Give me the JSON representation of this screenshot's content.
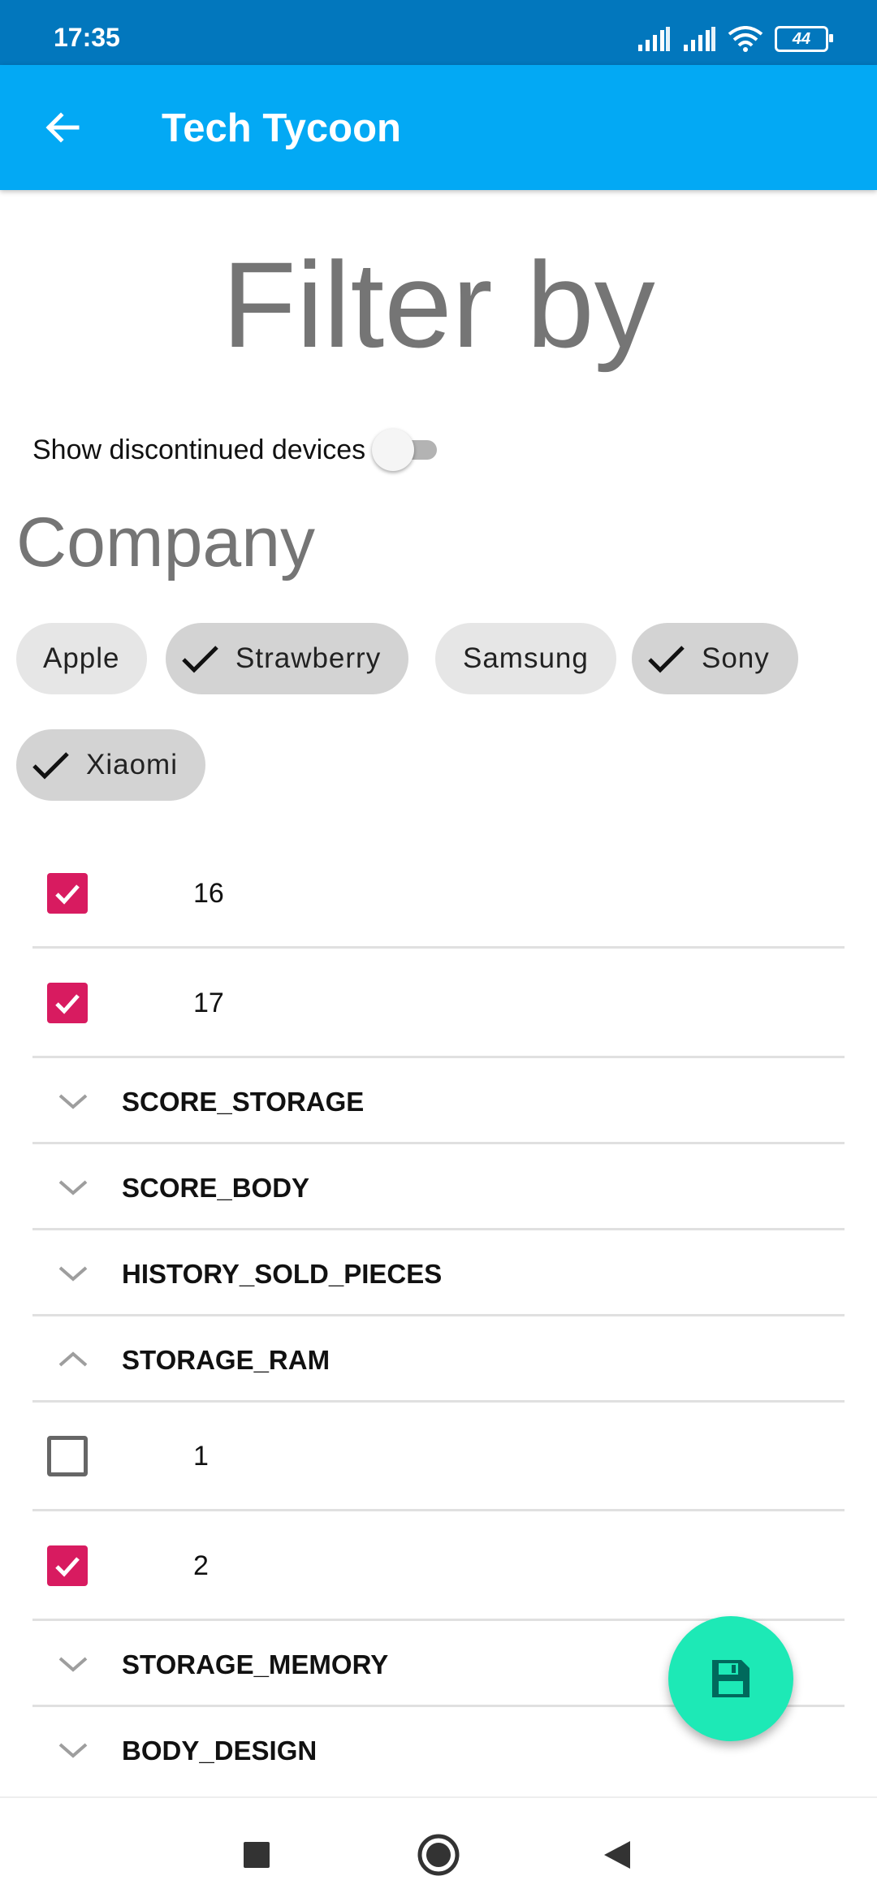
{
  "status_bar": {
    "time": "17:35",
    "battery": "44"
  },
  "app_bar": {
    "title": "Tech Tycoon"
  },
  "filter": {
    "title": "Filter by",
    "show_discontinued_label": "Show discontinued devices",
    "show_discontinued_on": false
  },
  "company": {
    "heading": "Company",
    "chips": [
      {
        "label": "Apple",
        "selected": false
      },
      {
        "label": "Strawberry",
        "selected": true
      },
      {
        "label": "Samsung",
        "selected": false
      },
      {
        "label": "Sony",
        "selected": true
      },
      {
        "label": "Xiaomi",
        "selected": true
      }
    ]
  },
  "list": {
    "options_top": [
      {
        "label": "16",
        "checked": true
      },
      {
        "label": "17",
        "checked": true
      }
    ],
    "sections": [
      {
        "label": "SCORE_STORAGE",
        "expanded": false
      },
      {
        "label": "SCORE_BODY",
        "expanded": false
      },
      {
        "label": "HISTORY_SOLD_PIECES",
        "expanded": false
      },
      {
        "label": "STORAGE_RAM",
        "expanded": true
      },
      {
        "label": "STORAGE_MEMORY",
        "expanded": false
      },
      {
        "label": "BODY_DESIGN",
        "expanded": false
      }
    ],
    "storage_ram_options": [
      {
        "label": "1",
        "checked": false
      },
      {
        "label": "2",
        "checked": true
      }
    ]
  },
  "fab": {
    "icon": "save-icon"
  },
  "colors": {
    "app_bar": "#03a9f4",
    "status_bar": "#0277bd",
    "checkbox_checked": "#d81b60",
    "fab": "#1de9b6"
  }
}
